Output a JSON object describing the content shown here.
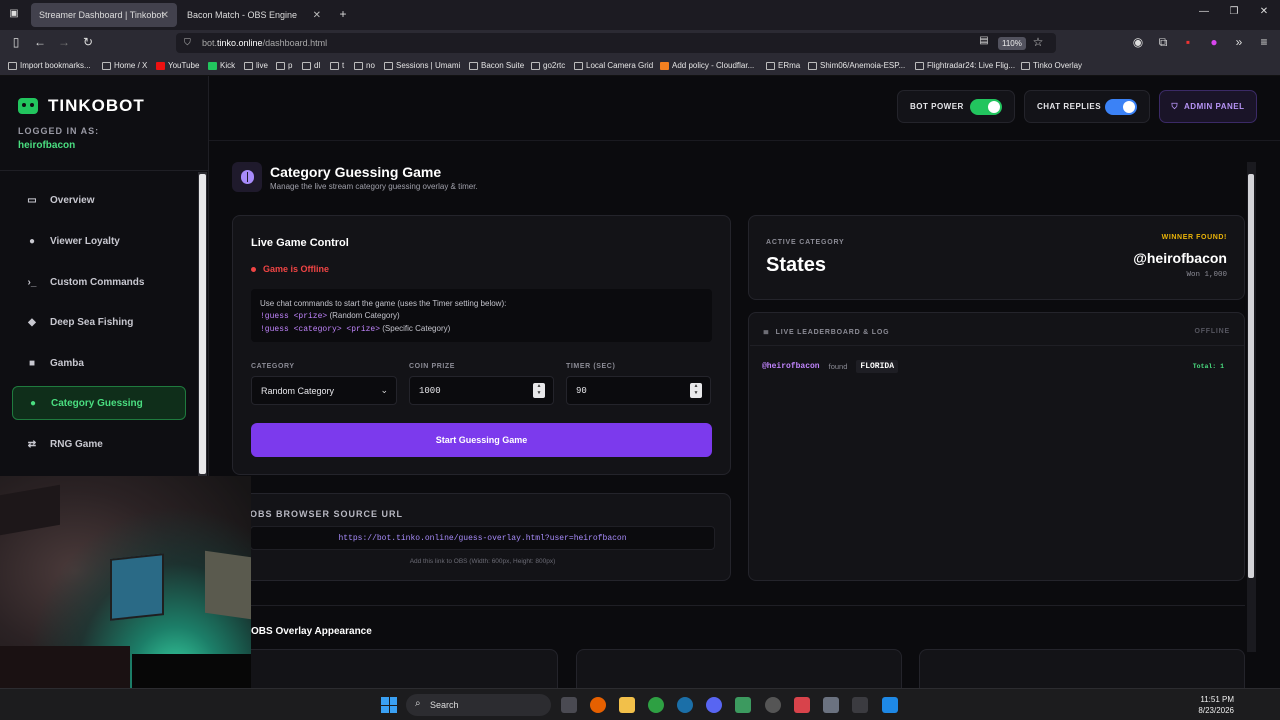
{
  "browser": {
    "tabs": [
      {
        "label": "Streamer Dashboard | Tinkobot"
      },
      {
        "label": "Bacon Match - OBS Engine"
      }
    ],
    "new_tab": "+",
    "url_prefix": "bot.",
    "url_domain": "tinko.online",
    "url_path": "/dashboard.html",
    "zoom": "110%",
    "bookmarks": [
      "Import bookmarks...",
      "Home / X",
      "YouTube",
      "Kick",
      "live",
      "p",
      "dl",
      "t",
      "no",
      "Sessions | Umami",
      "Bacon Suite",
      "go2rtc",
      "Local Camera Grid",
      "Add policy - Cloudflar...",
      "ERma",
      "Shim06/Anemoia-ESP...",
      "Flightradar24: Live Flig...",
      "Tinko Overlay"
    ]
  },
  "sidebar": {
    "brand": "TINKOBOT",
    "logged_label": "LOGGED IN AS:",
    "username": "heirofbacon",
    "items": [
      {
        "label": "Overview",
        "icon": "monitor-icon"
      },
      {
        "label": "Viewer Loyalty",
        "icon": "users-icon"
      },
      {
        "label": "Custom Commands",
        "icon": "terminal-icon"
      },
      {
        "label": "Deep Sea Fishing",
        "icon": "fish-icon"
      },
      {
        "label": "Gamba",
        "icon": "dice-icon"
      },
      {
        "label": "Category Guessing",
        "icon": "brain-icon"
      },
      {
        "label": "RNG Game",
        "icon": "random-icon"
      }
    ]
  },
  "topbar": {
    "bot_power": "BOT POWER",
    "chat_replies": "CHAT REPLIES",
    "admin_panel": "ADMIN PANEL",
    "colors": {
      "bot_power": "#22c55e",
      "chat_replies": "#3b82f6"
    }
  },
  "page": {
    "title": "Category Guessing Game",
    "subtitle": "Manage the live stream category guessing overlay & timer."
  },
  "control": {
    "title": "Live Game Control",
    "status": "Game is Offline",
    "instructions": "Use chat commands to start the game (uses the Timer setting below):",
    "cmd1": "!guess <prize>",
    "cmd1_desc": " (Random Category)",
    "cmd2": "!guess <category> <prize>",
    "cmd2_desc": " (Specific Category)",
    "category_label": "CATEGORY",
    "category_value": "Random Category",
    "prize_label": "COIN PRIZE",
    "prize_value": "1000",
    "timer_label": "TIMER (SEC)",
    "timer_value": "90",
    "start_button": "Start Guessing Game"
  },
  "obs": {
    "title": "OBS BROWSER SOURCE URL",
    "url": "https://bot.tinko.online/guess-overlay.html?user=heirofbacon",
    "hint": "Add this link to OBS (Width: 600px, Height: 800px)"
  },
  "active": {
    "label": "ACTIVE CATEGORY",
    "category": "States",
    "winner_label": "WINNER FOUND!",
    "winner": "@heirofbacon",
    "won": "Won 1,000"
  },
  "leaderboard": {
    "title": "LIVE LEADERBOARD & LOG",
    "status": "OFFLINE",
    "rows": [
      {
        "user": "@heirofbacon",
        "action": "found",
        "category": "FLORIDA",
        "total": "Total: 1"
      }
    ]
  },
  "overlay": {
    "title": "OBS Overlay Appearance"
  },
  "taskbar": {
    "search": "Search",
    "time": "11:51 PM",
    "date": "8/23/2026"
  }
}
